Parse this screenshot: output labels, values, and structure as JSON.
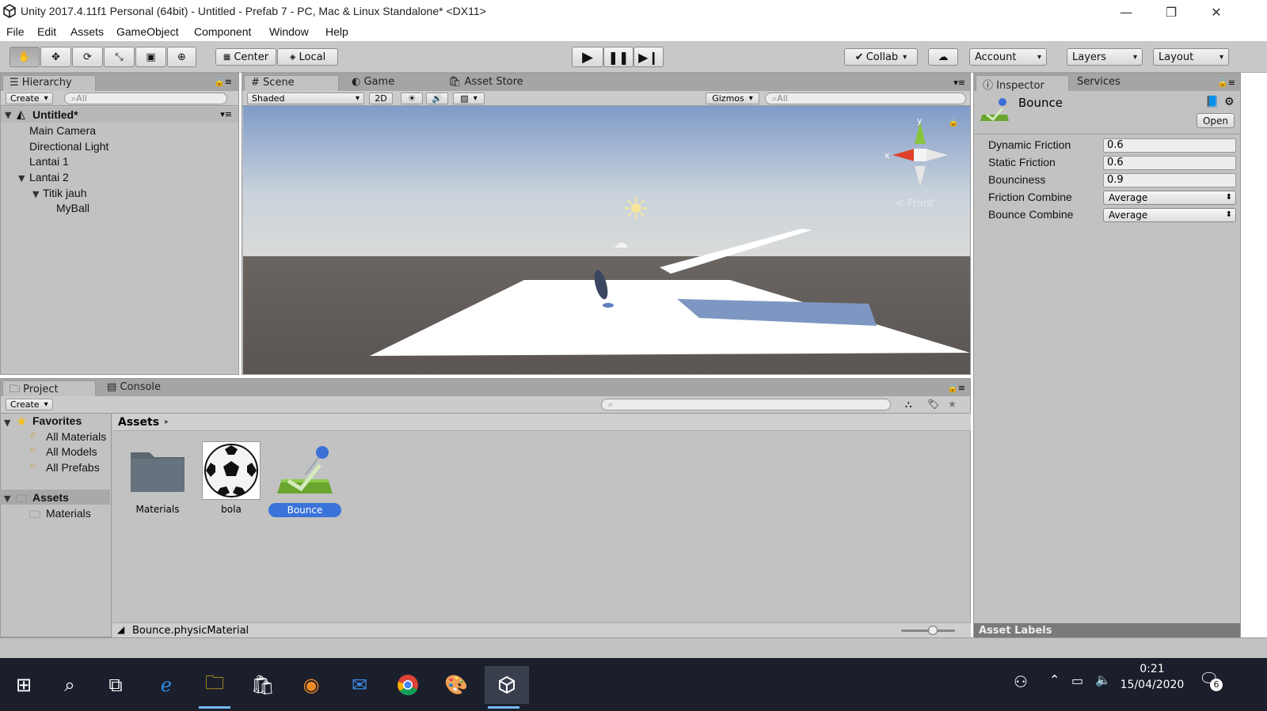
{
  "window": {
    "title": "Unity 2017.4.11f1 Personal (64bit) - Untitled - Prefab 7 - PC, Mac & Linux Standalone* <DX11>",
    "minimize": "—",
    "restore": "❐",
    "close": "✕"
  },
  "menu": [
    "File",
    "Edit",
    "Assets",
    "GameObject",
    "Component",
    "Window",
    "Help"
  ],
  "toolbar": {
    "pivot": "Center",
    "space": "Local",
    "collab": "Collab",
    "account": "Account",
    "layers": "Layers",
    "layout": "Layout"
  },
  "hierarchy": {
    "tab": "Hierarchy",
    "create": "Create",
    "search_placeholder": "All",
    "scene": "Untitled*",
    "items": [
      "Main Camera",
      "Directional Light",
      "Lantai 1",
      "Lantai 2",
      "Titik jauh",
      "MyBall"
    ]
  },
  "scene_view": {
    "tabs": [
      "Scene",
      "Game",
      "Asset Store"
    ],
    "shading": "Shaded",
    "mode2d": "2D",
    "gizmos": "Gizmos",
    "search_placeholder": "All",
    "view_label": "Front",
    "axis_y": "y",
    "axis_x": "x"
  },
  "inspector": {
    "tabs": [
      "Inspector",
      "Services"
    ],
    "asset_name": "Bounce",
    "open_button": "Open",
    "properties": [
      {
        "label": "Dynamic Friction",
        "value": "0.6"
      },
      {
        "label": "Static Friction",
        "value": "0.6"
      },
      {
        "label": "Bounciness",
        "value": "0.9"
      },
      {
        "label": "Friction Combine",
        "value": "Average"
      },
      {
        "label": "Bounce Combine",
        "value": "Average"
      }
    ],
    "asset_labels": "Asset Labels"
  },
  "project": {
    "tabs": [
      "Project",
      "Console"
    ],
    "create": "Create",
    "favorites": "Favorites",
    "favorite_items": [
      "All Materials",
      "All Models",
      "All Prefabs"
    ],
    "assets_root": "Assets",
    "asset_folders": [
      "Materials"
    ],
    "breadcrumb": "Assets",
    "grid_items": [
      "Materials",
      "bola",
      "Bounce"
    ],
    "selected_path": "Bounce.physicMaterial"
  },
  "taskbar": {
    "time": "0:21",
    "date": "15/04/2020",
    "notifications": "6"
  },
  "colors": {
    "selection": "#3a73d9",
    "panel": "#c2c2c2",
    "taskbar": "#1b1f2c"
  }
}
